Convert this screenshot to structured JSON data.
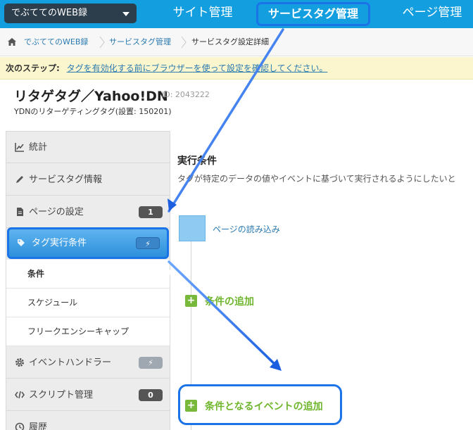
{
  "topbar": {
    "account_select": "でぶててのWEB録",
    "nav": {
      "site": "サイト管理",
      "tag": "サービスタグ管理",
      "page": "ページ管理"
    }
  },
  "breadcrumb": {
    "items": [
      "でぶててのWEB録",
      "サービスタグ管理",
      "サービスタグ設定詳細"
    ]
  },
  "next_step": {
    "label": "次のステップ:",
    "link": "タグを有効化する前にブラウザーを使って設定を確認してください。"
  },
  "tag": {
    "title": "リタゲタグ／Yahoo!DN",
    "id": "ID: 2043222",
    "description": "YDNのリターゲティングタグ(設置: 150201)"
  },
  "sidebar": {
    "items": [
      {
        "label": "統計",
        "icon": "chart-icon"
      },
      {
        "label": "サービスタグ情報",
        "icon": "pencil-icon"
      },
      {
        "label": "ページの設定",
        "icon": "document-icon",
        "badge": "1"
      },
      {
        "label": "タグ実行条件",
        "icon": "tag-icon",
        "badge": "⚡"
      },
      {
        "label": "イベントハンドラー",
        "icon": "gear-icon",
        "badge": "⚡"
      },
      {
        "label": "スクリプト管理",
        "icon": "code-icon",
        "badge": "0"
      },
      {
        "label": "履歴",
        "icon": "clock-icon"
      }
    ],
    "sub_items": [
      "条件",
      "スケジュール",
      "フリークエンシーキャップ"
    ]
  },
  "main": {
    "title": "実行条件",
    "description": "タグが特定のデータの値やイベントに基づいて実行されるようにしたいと",
    "event_label": "ページの読み込み",
    "add_condition": "条件の追加",
    "add_event_condition": "条件となるイベントの追加"
  },
  "colors": {
    "topbar": "#139fdf",
    "highlight": "#1b73e8",
    "add_green": "#6fb52c"
  }
}
